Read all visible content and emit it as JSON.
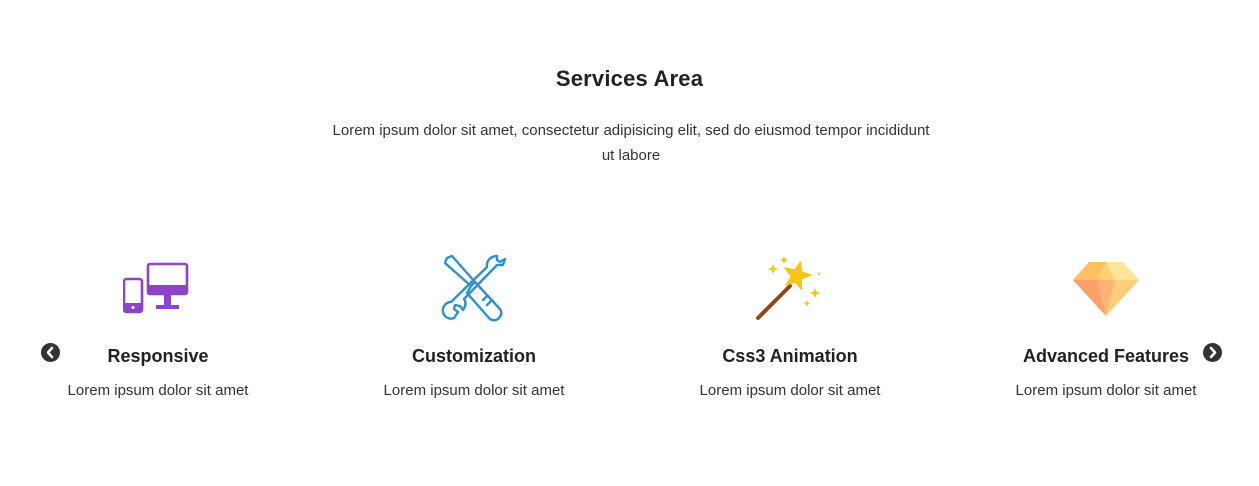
{
  "section": {
    "title": "Services Area",
    "description": "Lorem ipsum dolor sit amet, consectetur adipisicing elit, sed do eiusmod tempor incididunt ut labore"
  },
  "services": [
    {
      "icon": "devices-icon",
      "title": "Responsive",
      "text": "Lorem ipsum dolor sit amet"
    },
    {
      "icon": "tools-icon",
      "title": "Customization",
      "text": "Lorem ipsum dolor sit amet"
    },
    {
      "icon": "magic-wand-icon",
      "title": "Css3 Animation",
      "text": "Lorem ipsum dolor sit amet"
    },
    {
      "icon": "diamond-icon",
      "title": "Advanced Features",
      "text": "Lorem ipsum dolor sit amet"
    }
  ],
  "colors": {
    "devices": "#8e44c8",
    "tools": "#2f8fd0",
    "wand_star": "#f5c518",
    "wand_stick": "#8b4a1c",
    "diamond_light": "#ffd778",
    "diamond_dark": "#ff9f6b",
    "arrow": "#333333"
  },
  "carousel": {
    "prev_icon": "chevron-left-circle-icon",
    "next_icon": "chevron-right-circle-icon"
  }
}
